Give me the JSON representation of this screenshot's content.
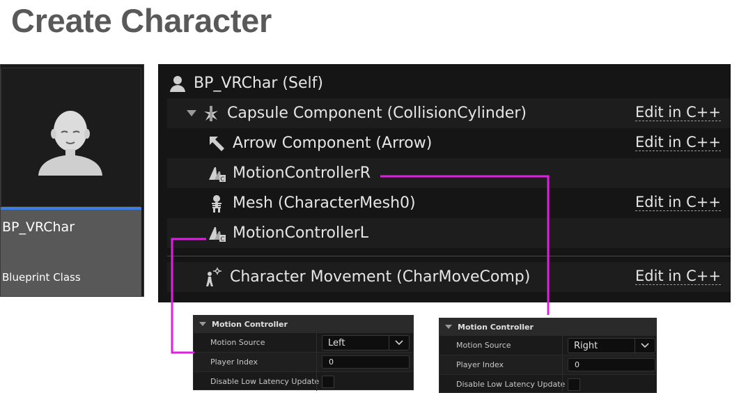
{
  "page_title": "Create Character",
  "asset": {
    "name": "BP_VRChar",
    "type": "Blueprint Class",
    "icon": "character-icon"
  },
  "component_tree": {
    "root": {
      "label": "BP_VRChar (Self)",
      "icon": "character-icon"
    },
    "items": [
      {
        "label": "Capsule Component (CollisionCylinder)",
        "icon": "capsule-icon",
        "action": "Edit in C++"
      },
      {
        "label": "Arrow Component (Arrow)",
        "icon": "arrow-icon",
        "action": "Edit in C++"
      },
      {
        "label": "MotionControllerR",
        "icon": "motion-controller-icon",
        "action": ""
      },
      {
        "label": "Mesh (CharacterMesh0)",
        "icon": "skeleton-icon",
        "action": "Edit in C++"
      },
      {
        "label": "MotionControllerL",
        "icon": "motion-controller-icon",
        "action": ""
      }
    ],
    "movement": {
      "label": "Character Movement (CharMoveComp)",
      "icon": "movement-icon",
      "action": "Edit in C++"
    }
  },
  "details_left": {
    "section": "Motion Controller",
    "motion_source_label": "Motion Source",
    "motion_source_value": "Left",
    "player_index_label": "Player Index",
    "player_index_value": "0",
    "disable_low_latency_label": "Disable Low Latency Update"
  },
  "details_right": {
    "section": "Motion Controller",
    "motion_source_label": "Motion Source",
    "motion_source_value": "Right",
    "player_index_label": "Player Index",
    "player_index_value": "0",
    "disable_low_latency_label": "Disable Low Latency Update"
  },
  "colors": {
    "connector": "#e01fe0",
    "selection_bar": "#3d7fe0"
  }
}
